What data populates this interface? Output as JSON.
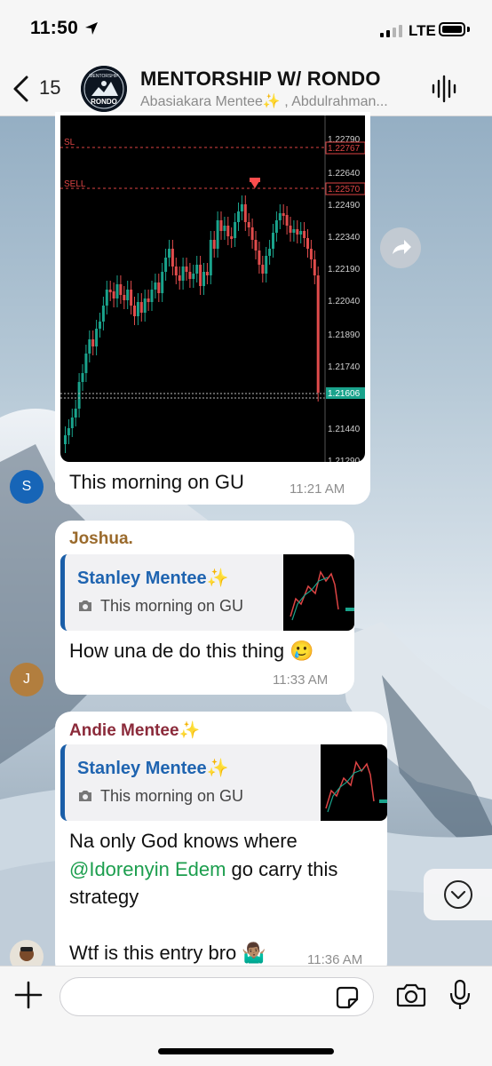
{
  "status": {
    "time": "11:50",
    "network": "LTE"
  },
  "header": {
    "back_count": "15",
    "title": "MENTORSHIP W/ RONDO",
    "subtitle": "Abasiakara Mentee✨ , Abdulrahman...",
    "avatar_text_top": "MENTORSHIP",
    "avatar_text_bottom": "RONDO"
  },
  "chart_image": {
    "labels": [
      "SL",
      "SELL"
    ],
    "prices": [
      "1.22790",
      "1.22767",
      "1.22640",
      "1.22570",
      "1.22490",
      "1.22340",
      "1.22190",
      "1.22040",
      "1.21890",
      "1.21740",
      "1.21606",
      "1.21440",
      "1.21290"
    ]
  },
  "messages": [
    {
      "avatar": "S",
      "text": "This morning on GU",
      "time": "11:21 AM"
    },
    {
      "avatar": "J",
      "sender": "Joshua.",
      "quote_name": "Stanley Mentee✨",
      "quote_text": "This morning on GU",
      "text": "How una de do this thing 🥲",
      "time": "11:33 AM"
    },
    {
      "sender": "Andie Mentee✨",
      "quote_name": "Stanley Mentee✨",
      "quote_text": "This morning on GU",
      "line1": "Na only God knows where",
      "mention": "@Idorenyin Edem",
      "line2_rest": " go carry this",
      "line3": "strategy",
      "line4": "Wtf is this entry bro 🤷🏽‍♂️",
      "time": "11:36 AM"
    }
  ],
  "input": {
    "placeholder": ""
  },
  "colors": {
    "joshua": "#9a6a2c",
    "andie": "#8b2a3a",
    "quote_name": "#1f64b0",
    "mention": "#1c9e4e"
  }
}
